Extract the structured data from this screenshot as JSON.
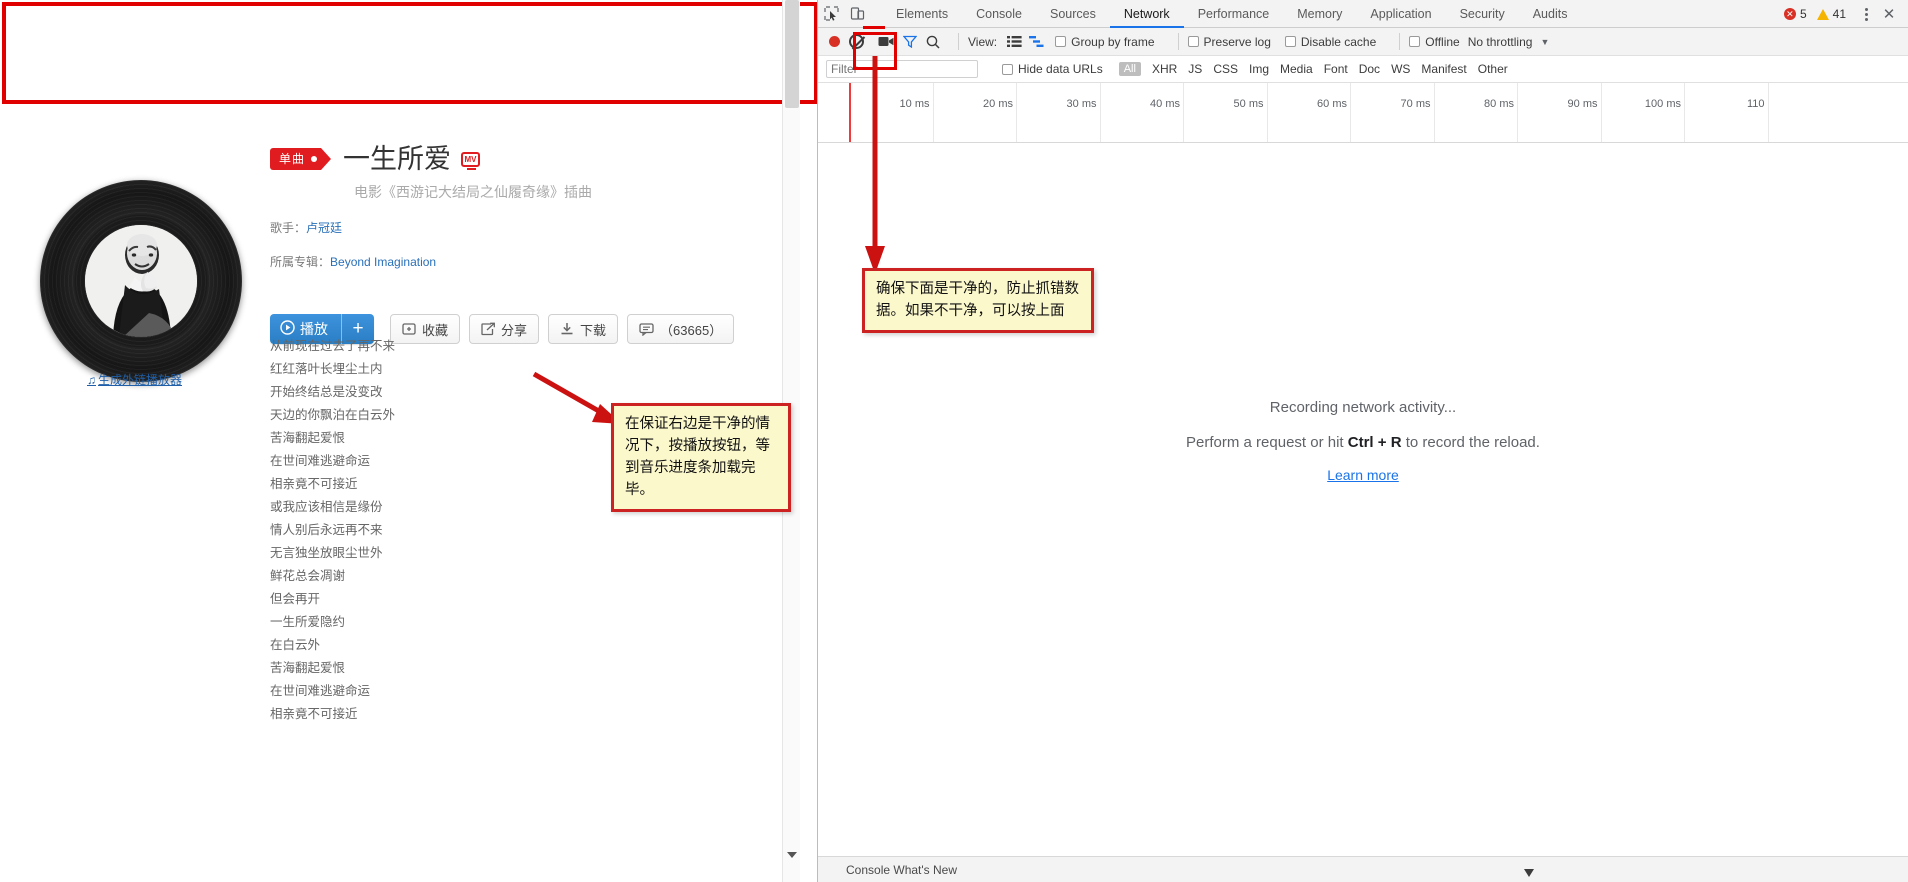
{
  "page": {
    "ad_banner": "",
    "song": {
      "tag": "单曲",
      "title": "一生所爱",
      "mv_badge": "MV",
      "subtitle": "电影《西游记大结局之仙履奇缘》插曲",
      "singer_label": "歌手：",
      "singer_value": "卢冠廷",
      "album_label": "所属专辑：",
      "album_value": "Beyond Imagination"
    },
    "buttons": {
      "play": "播放",
      "plus": "+",
      "favorite": "收藏",
      "share": "分享",
      "download": "下载",
      "comment": "（63665）"
    },
    "external_link": "生成外链播放器",
    "lyrics": [
      "从前现在过去了再不来",
      "红红落叶长埋尘土内",
      "开始终结总是没变改",
      "天边的你飘泊在白云外",
      "苦海翻起爱恨",
      "在世间难逃避命运",
      "相亲竟不可接近",
      "或我应该相信是缘份",
      "情人别后永远再不来",
      "无言独坐放眼尘世外",
      "鲜花总会凋谢",
      "但会再开",
      "一生所爱隐约",
      "在白云外",
      "苦海翻起爱恨",
      "在世间难逃避命运",
      "相亲竟不可接近"
    ]
  },
  "annotations": {
    "left_note": "在保证右边是干净的情况下，按播放按钮，等到音乐进度条加载完毕。",
    "right_note": "确保下面是干净的，防止抓错数据。如果不干净，可以按上面"
  },
  "devtools": {
    "tabs": [
      {
        "label": "Elements",
        "active": false
      },
      {
        "label": "Console",
        "active": false
      },
      {
        "label": "Sources",
        "active": false
      },
      {
        "label": "Network",
        "active": true
      },
      {
        "label": "Performance",
        "active": false
      },
      {
        "label": "Memory",
        "active": false
      },
      {
        "label": "Application",
        "active": false
      },
      {
        "label": "Security",
        "active": false
      },
      {
        "label": "Audits",
        "active": false
      }
    ],
    "error_count": "5",
    "warning_count": "41",
    "close_label": "✕",
    "toolbar": {
      "view_label": "View:",
      "group_by_frame": "Group by frame",
      "preserve_log": "Preserve log",
      "disable_cache": "Disable cache",
      "offline": "Offline",
      "throttling": "No throttling"
    },
    "filter": {
      "placeholder": "Filter",
      "value": "",
      "hide_data_urls": "Hide data URLs",
      "types": [
        "All",
        "XHR",
        "JS",
        "CSS",
        "Img",
        "Media",
        "Font",
        "Doc",
        "WS",
        "Manifest",
        "Other"
      ]
    },
    "ruler_ticks": [
      "10 ms",
      "20 ms",
      "30 ms",
      "40 ms",
      "50 ms",
      "60 ms",
      "70 ms",
      "80 ms",
      "90 ms",
      "100 ms",
      "110"
    ],
    "empty_state": {
      "line1": "Recording network activity...",
      "line2_pre": "Perform a request or hit ",
      "line2_key": "Ctrl + R",
      "line2_post": " to record the reload.",
      "link": "Learn more"
    },
    "bottom_bar": "Console   What's New"
  },
  "colors": {
    "accent_red": "#e01c20",
    "highlight_red": "#e00000",
    "note_bg": "#fbf8cc",
    "link_blue": "#1a73e8",
    "play_blue": "#2a7ec4"
  }
}
